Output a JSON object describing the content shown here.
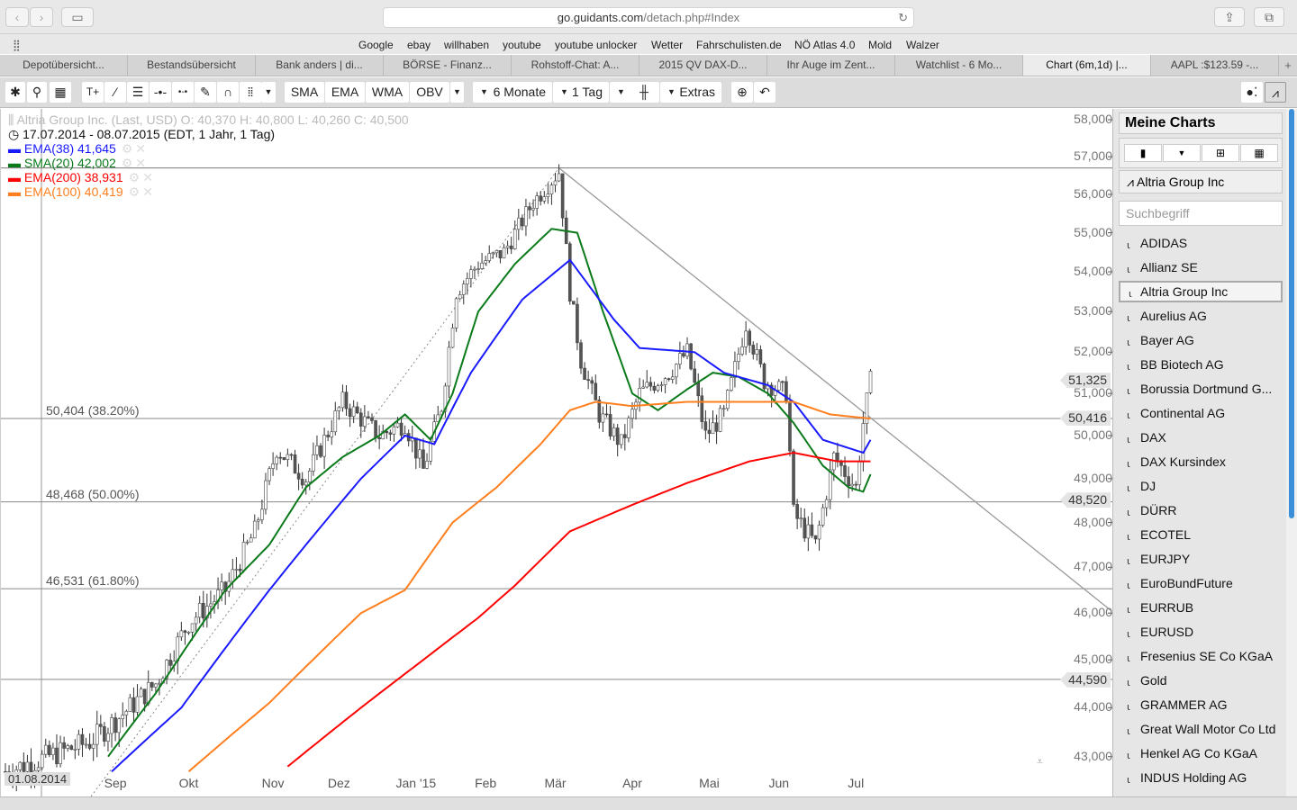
{
  "browser": {
    "url_domain": "go.guidants.com",
    "url_path": "/detach.php#Index",
    "bookmarks": [
      "Google",
      "ebay",
      "willhaben",
      "youtube",
      "youtube unlocker",
      "Wetter",
      "Fahrschulisten.de",
      "NÖ Atlas 4.0",
      "Mold",
      "Walzer"
    ],
    "tabs": [
      "Depotübersicht...",
      "Bestandsübersicht",
      "Bank anders | di...",
      "BÖRSE - Finanz...",
      "Rohstoff-Chat: A...",
      "2015 QV DAX-D...",
      "Ihr Auge im Zent...",
      "Watchlist - 6 Mo...",
      "Chart (6m,1d) |...",
      "AAPL :$123.59 -..."
    ],
    "active_tab": 8
  },
  "toolbar": {
    "sma": "SMA",
    "ema": "EMA",
    "wma": "WMA",
    "obv": "OBV",
    "range": "6 Monate",
    "interval": "1 Tag",
    "extras": "Extras"
  },
  "legend": {
    "title": "Altria Group Inc. (Last, USD)  O: 40,370  H: 40,800  L: 40,260  C: 40,500",
    "period": "17.07.2014 - 08.07.2015 (EDT, 1 Jahr, 1 Tag)",
    "indicators": [
      {
        "label": "EMA(38) 41,645",
        "color": "#1a1aff"
      },
      {
        "label": "SMA(20) 42,002",
        "color": "#0a7a1a"
      },
      {
        "label": "EMA(200) 38,931",
        "color": "#ff0000"
      },
      {
        "label": "EMA(100) 40,419",
        "color": "#ff7f1e"
      }
    ]
  },
  "sidebar": {
    "title": "Meine Charts",
    "current": "Altria Group Inc",
    "search_placeholder": "Suchbegriff",
    "items": [
      "ADIDAS",
      "Allianz SE",
      "Altria Group Inc",
      "Aurelius AG",
      "Bayer AG",
      "BB Biotech AG",
      "Borussia Dortmund G...",
      "Continental AG",
      "DAX",
      "DAX Kursindex",
      "DJ",
      "DÜRR",
      "ECOTEL",
      "EURJPY",
      "EuroBundFuture",
      "EURRUB",
      "EURUSD",
      "Fresenius SE Co KGaA",
      "Gold",
      "GRAMMER AG",
      "Great Wall Motor Co Ltd",
      "Henkel AG Co KGaA",
      "INDUS Holding AG"
    ],
    "selected": 2
  },
  "chart_data": {
    "type": "candlestick",
    "scale": "log",
    "ylim": [
      42700,
      58300
    ],
    "yticks": [
      58000,
      57000,
      56000,
      55000,
      54000,
      53000,
      52000,
      51000,
      50000,
      49000,
      48000,
      47000,
      46000,
      45000,
      44000,
      43000
    ],
    "ytick_labels": [
      "58,000",
      "57,000",
      "56,000",
      "55,000",
      "54,000",
      "53,000",
      "52,000",
      "51,000",
      "50,000",
      "49,000",
      "48,000",
      "47,000",
      "46,000",
      "45,000",
      "44,000",
      "43,000"
    ],
    "xrange_days": [
      0,
      236
    ],
    "months": [
      {
        "label": "Sep",
        "day": 30
      },
      {
        "label": "Okt",
        "day": 50
      },
      {
        "label": "Nov",
        "day": 73
      },
      {
        "label": "Dez",
        "day": 91
      },
      {
        "label": "Jan '15",
        "day": 112
      },
      {
        "label": "Feb",
        "day": 131
      },
      {
        "label": "Mär",
        "day": 150
      },
      {
        "label": "Apr",
        "day": 171
      },
      {
        "label": "Mai",
        "day": 192
      },
      {
        "label": "Jun",
        "day": 211
      },
      {
        "label": "Jul",
        "day": 232
      }
    ],
    "start_date_label": "01.08.2014",
    "fib_levels": [
      {
        "label": "50,404 (38.20%)",
        "value": 50404
      },
      {
        "label": "48,468 (50.00%)",
        "value": 48468
      },
      {
        "label": "46,531 (61.80%)",
        "value": 46531
      }
    ],
    "price_markers": [
      {
        "label": "51,325",
        "value": 51325
      },
      {
        "label": "50,416",
        "value": 50416
      },
      {
        "label": "48,520",
        "value": 48520
      },
      {
        "label": "44,590",
        "value": 44590
      }
    ],
    "high_line": 56700,
    "close": [
      [
        0,
        42700
      ],
      [
        23,
        43300
      ],
      [
        31,
        43800
      ],
      [
        41,
        44500
      ],
      [
        50,
        45800
      ],
      [
        60,
        46500
      ],
      [
        68,
        47800
      ],
      [
        74,
        49700
      ],
      [
        82,
        49000
      ],
      [
        92,
        50800
      ],
      [
        102,
        50000
      ],
      [
        109,
        50300
      ],
      [
        114,
        49200
      ],
      [
        119,
        50700
      ],
      [
        123,
        53500
      ],
      [
        129,
        54200
      ],
      [
        136,
        54500
      ],
      [
        144,
        55800
      ],
      [
        151,
        56600
      ],
      [
        154,
        53500
      ],
      [
        157,
        51800
      ],
      [
        162,
        50500
      ],
      [
        168,
        49800
      ],
      [
        173,
        51000
      ],
      [
        181,
        51500
      ],
      [
        186,
        52000
      ],
      [
        191,
        50000
      ],
      [
        196,
        50500
      ],
      [
        202,
        52700
      ],
      [
        207,
        51300
      ],
      [
        213,
        51000
      ],
      [
        215,
        48200
      ],
      [
        221,
        47500
      ],
      [
        226,
        49500
      ],
      [
        232,
        48800
      ],
      [
        234,
        50300
      ],
      [
        236,
        51300
      ]
    ],
    "series": [
      {
        "name": "SMA(20)",
        "color": "#0a7a1a",
        "points": [
          [
            28,
            43000
          ],
          [
            41,
            44300
          ],
          [
            60,
            46500
          ],
          [
            72,
            47500
          ],
          [
            82,
            48800
          ],
          [
            92,
            49500
          ],
          [
            102,
            50000
          ],
          [
            109,
            50500
          ],
          [
            116,
            49900
          ],
          [
            122,
            51000
          ],
          [
            129,
            53000
          ],
          [
            139,
            54200
          ],
          [
            149,
            55100
          ],
          [
            156,
            55000
          ],
          [
            163,
            53000
          ],
          [
            171,
            51000
          ],
          [
            178,
            50600
          ],
          [
            186,
            51100
          ],
          [
            193,
            51500
          ],
          [
            200,
            51400
          ],
          [
            208,
            51000
          ],
          [
            215,
            50300
          ],
          [
            223,
            49300
          ],
          [
            230,
            48800
          ],
          [
            234,
            48700
          ],
          [
            236,
            49100
          ]
        ]
      },
      {
        "name": "EMA(38)",
        "color": "#1a1aff",
        "points": [
          [
            29,
            42700
          ],
          [
            48,
            44000
          ],
          [
            72,
            46500
          ],
          [
            85,
            47800
          ],
          [
            97,
            49000
          ],
          [
            109,
            50000
          ],
          [
            117,
            49800
          ],
          [
            127,
            51500
          ],
          [
            141,
            53300
          ],
          [
            154,
            54300
          ],
          [
            166,
            52800
          ],
          [
            173,
            52100
          ],
          [
            188,
            52000
          ],
          [
            196,
            51500
          ],
          [
            208,
            51200
          ],
          [
            215,
            50800
          ],
          [
            223,
            49900
          ],
          [
            234,
            49600
          ],
          [
            236,
            49900
          ]
        ]
      },
      {
        "name": "EMA(100)",
        "color": "#ff7f1e",
        "points": [
          [
            50,
            42700
          ],
          [
            72,
            44100
          ],
          [
            97,
            46000
          ],
          [
            109,
            46500
          ],
          [
            122,
            48000
          ],
          [
            134,
            48800
          ],
          [
            146,
            49800
          ],
          [
            154,
            50600
          ],
          [
            161,
            50800
          ],
          [
            171,
            50700
          ],
          [
            186,
            50800
          ],
          [
            200,
            50800
          ],
          [
            215,
            50800
          ],
          [
            225,
            50500
          ],
          [
            236,
            50400
          ]
        ]
      },
      {
        "name": "EMA(200)",
        "color": "#ff0000",
        "points": [
          [
            77,
            42800
          ],
          [
            97,
            44000
          ],
          [
            114,
            45000
          ],
          [
            129,
            45900
          ],
          [
            139,
            46600
          ],
          [
            154,
            47800
          ],
          [
            171,
            48400
          ],
          [
            186,
            48900
          ],
          [
            203,
            49400
          ],
          [
            215,
            49600
          ],
          [
            227,
            49400
          ],
          [
            236,
            49400
          ]
        ]
      }
    ]
  }
}
